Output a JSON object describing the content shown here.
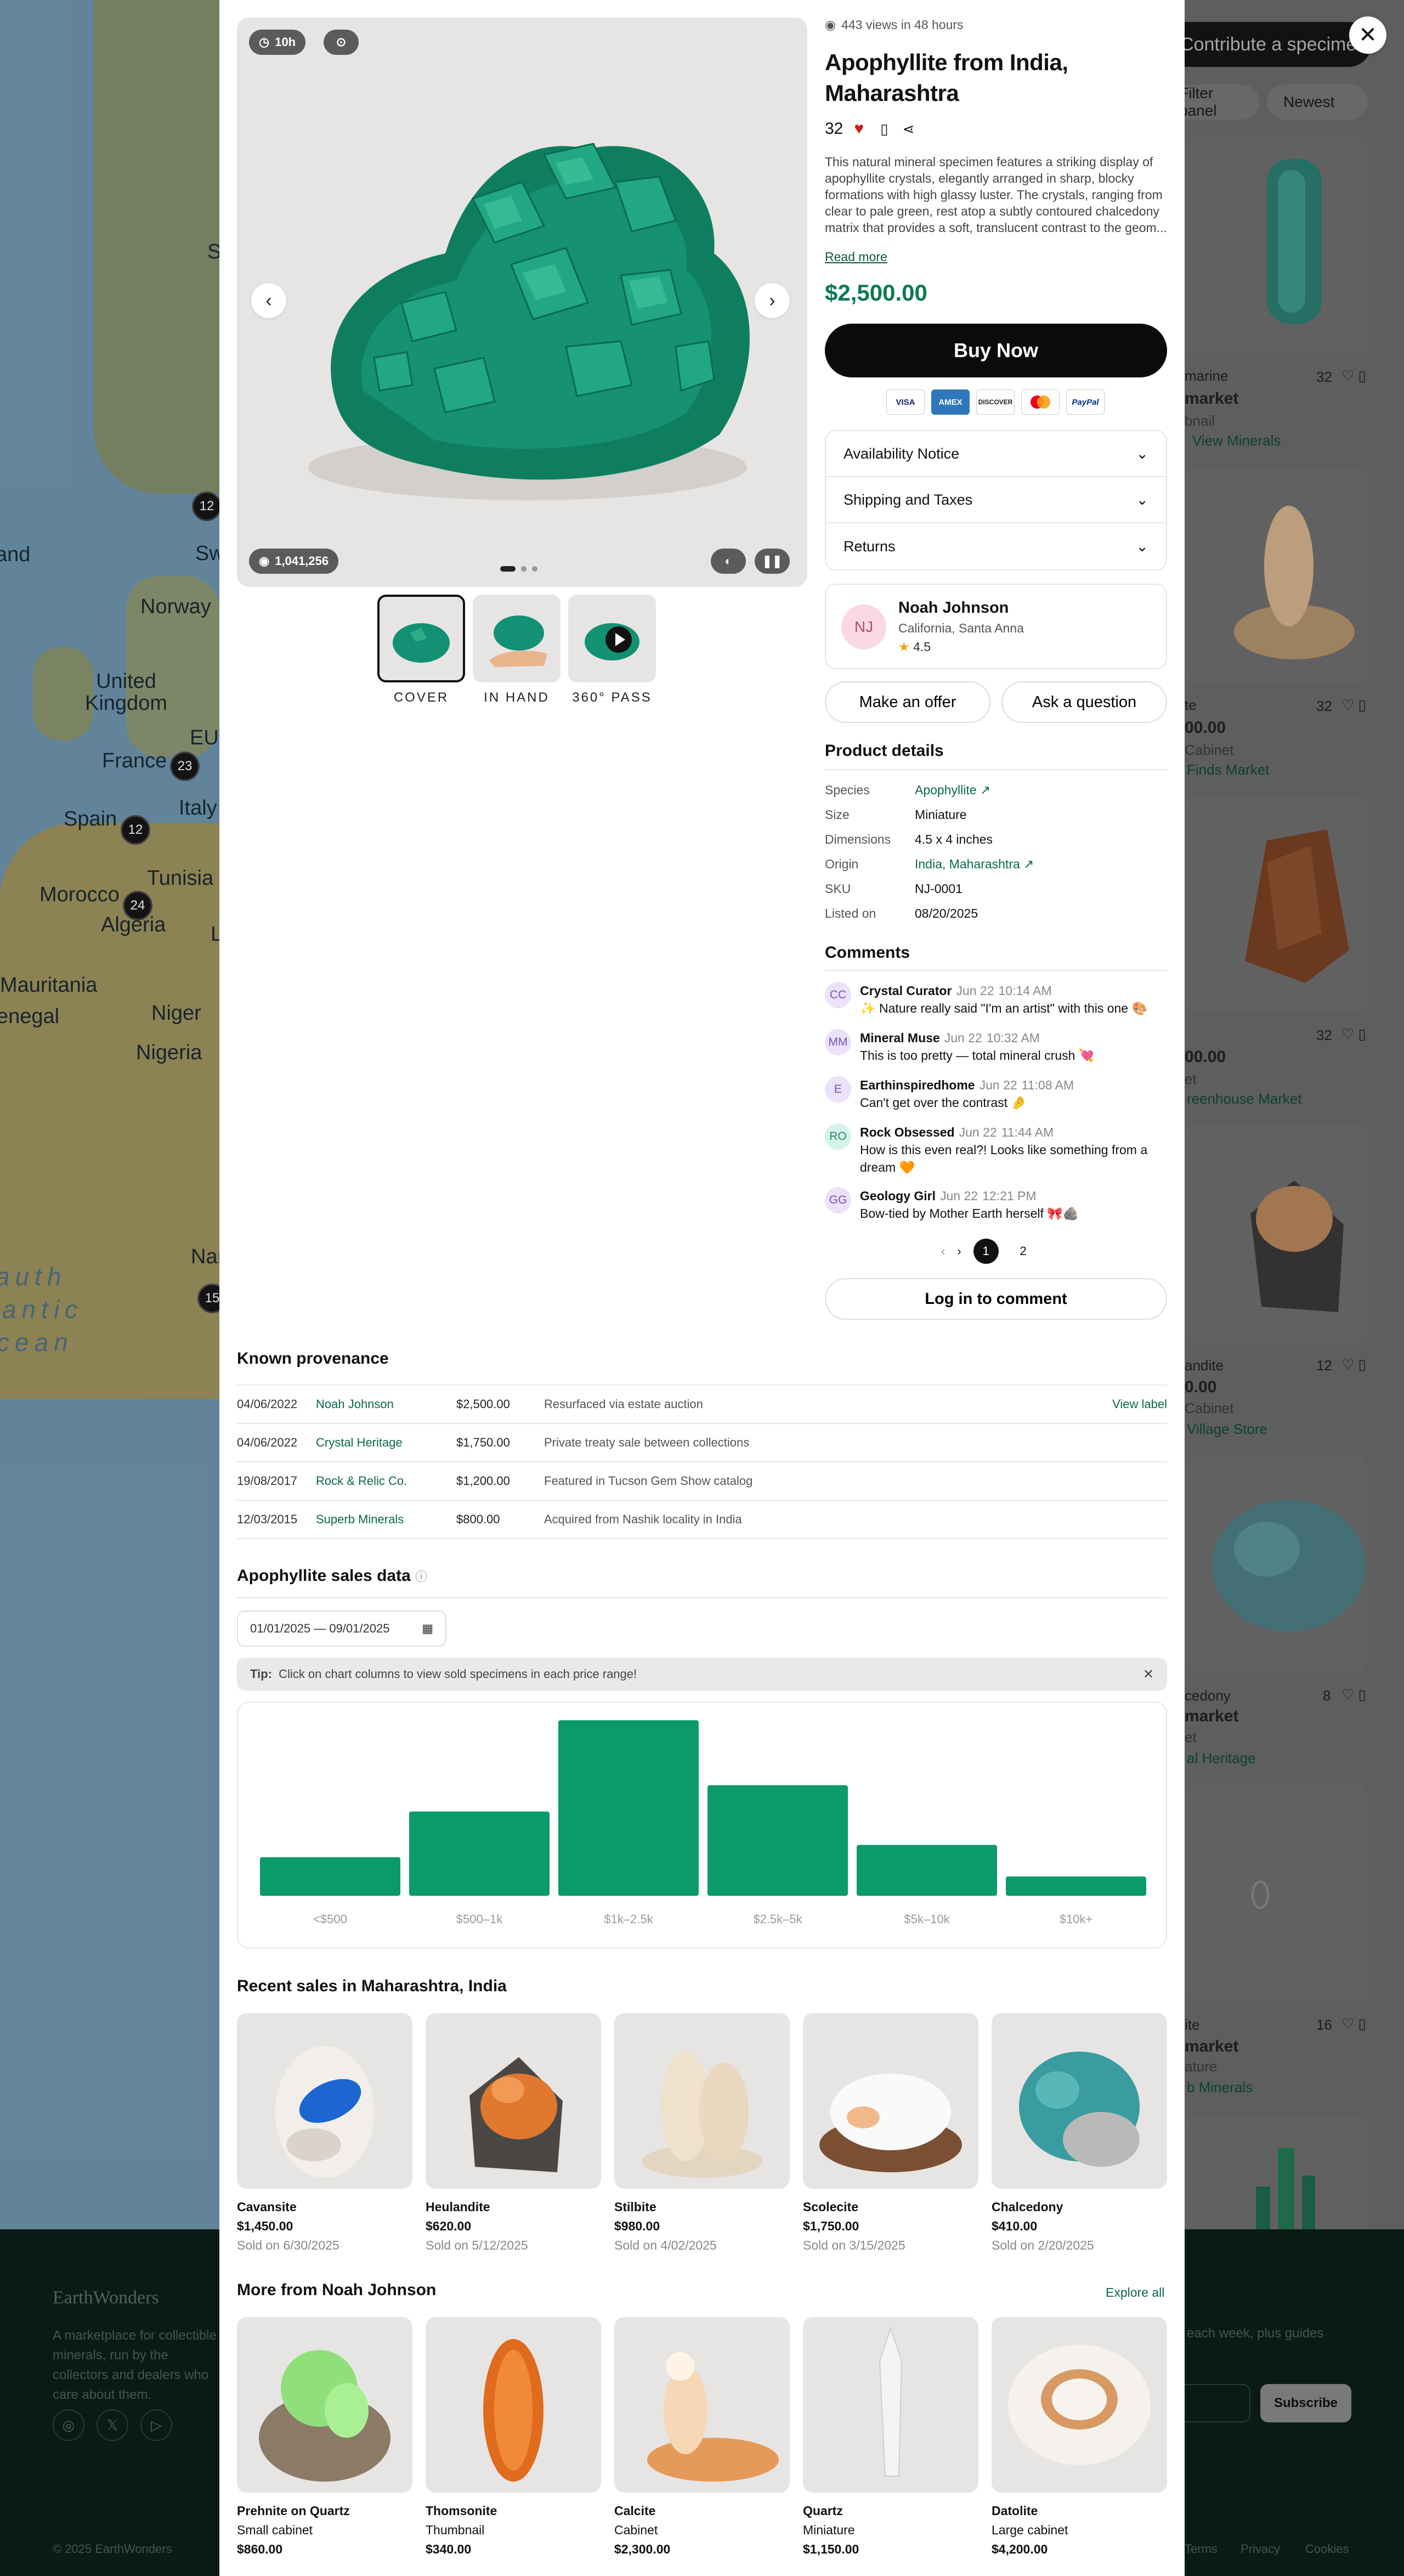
{
  "background": {
    "map_labels": [
      "and",
      "Norway",
      "United Kingdom",
      "France",
      "Spain",
      "Italy",
      "Tunisia",
      "Morocco",
      "Algeria",
      "Mauritania",
      "enegal",
      "Niger",
      "Nigeria",
      "Sw",
      "EU",
      "S",
      "L",
      "Nar"
    ],
    "ocean_label": [
      "auth",
      "antic",
      "cean"
    ],
    "clusters": [
      "12",
      "23",
      "12",
      "24",
      "15"
    ],
    "contribute_button": "Contribute a specimen",
    "filter_pill": "Filter panel",
    "sort_pill": "Newest",
    "cards": [
      {
        "type": "marine",
        "title": "market",
        "sub": "bnail",
        "link": "View Minerals",
        "likes": "32"
      },
      {
        "type": "te",
        "price": "00.00",
        "sub": "Cabinet",
        "link": "Finds Market",
        "likes": "32"
      },
      {
        "price": "00.00",
        "sub": "et",
        "link": "reenhouse Market",
        "likes": "32"
      },
      {
        "type": "andite",
        "price": "0.00",
        "sub": "Cabinet",
        "link": "Village Store",
        "likes": "12"
      },
      {
        "type": "cedony",
        "title": "market",
        "sub": "et",
        "link": "al Heritage",
        "likes": "8"
      },
      {
        "type": "ite",
        "title": "market",
        "sub": "ature",
        "link": "b Minerals",
        "likes": "16"
      }
    ],
    "footer": {
      "logo": "EarthWonders",
      "blurb": "A marketplace for collectible minerals, run by the collectors and dealers who care about them.",
      "newsletter_text": "each week, plus guides",
      "subscribe": "Subscribe",
      "copyright": "© 2025 EarthWonders",
      "links": [
        "Terms",
        "Privacy",
        "Cookies"
      ]
    }
  },
  "gallery": {
    "time_chip": "10h",
    "views_chip": "1,041,256",
    "thumbs": [
      "COVER",
      "IN HAND",
      "360° PASS"
    ]
  },
  "listing": {
    "views_meta": "443 views in 48 hours",
    "title": "Apophyllite from India, Maharashtra",
    "likes": "32",
    "description": "This natural mineral specimen features a striking display of apophyllite crystals, elegantly arranged in sharp, blocky formations with high glassy luster. The crystals, ranging from clear to pale green, rest atop a subtly contoured chalcedony matrix that provides a soft, translucent contrast to the geom...",
    "read_more": "Read more",
    "price": "$2,500.00",
    "buy_label": "Buy Now",
    "payment_methods": [
      "VISA",
      "AMEX",
      "DISCOVER",
      "MC",
      "PayPal"
    ],
    "accordion": [
      "Availability Notice",
      "Shipping and Taxes",
      "Returns"
    ]
  },
  "seller": {
    "initials": "NJ",
    "name": "Noah Johnson",
    "location": "California, Santa Anna",
    "rating": "4.5",
    "offer_label": "Make an offer",
    "question_label": "Ask a question"
  },
  "details": {
    "heading": "Product details",
    "rows": [
      {
        "k": "Species",
        "v": "Apophyllite"
      },
      {
        "k": "Size",
        "v": "Miniature"
      },
      {
        "k": "Dimensions",
        "v": "4.5 x 4 inches"
      },
      {
        "k": "Origin",
        "v": "India, Maharashtra"
      },
      {
        "k": "SKU",
        "v": "NJ-0001"
      },
      {
        "k": "Listed on",
        "v": "08/20/2025"
      }
    ]
  },
  "comments": {
    "heading": "Comments",
    "items": [
      {
        "initials": "CC",
        "name": "Crystal Curator",
        "date": "Jun 22",
        "time": "10:14 AM",
        "text": "✨ Nature really said \"I'm an artist\" with this one 🎨",
        "color": "#ece2fb"
      },
      {
        "initials": "MM",
        "name": "Mineral Muse",
        "date": "Jun 22",
        "time": "10:32 AM",
        "text": "This is too pretty — total mineral crush 💘",
        "color": "#ece2fb"
      },
      {
        "initials": "E",
        "name": "Earthinspiredhome",
        "date": "Jun 22",
        "time": "11:08 AM",
        "text": "Can't get over the contrast 🤌",
        "color": "#ece2fb"
      },
      {
        "initials": "RO",
        "name": "Rock Obsessed",
        "date": "Jun 22",
        "time": "11:44 AM",
        "text": "How is this even real?! Looks like something from a dream 🧡",
        "color": "#d6f3ea"
      },
      {
        "initials": "GG",
        "name": "Geology Girl",
        "date": "Jun 22",
        "time": "12:21 PM",
        "text": "Bow-tied by Mother Earth herself 🎀🪨",
        "color": "#ece2fb"
      }
    ],
    "pages": [
      "1",
      "2"
    ],
    "login_label": "Log in to comment"
  },
  "provenance": {
    "heading": "Known provenance",
    "view_label": "View label",
    "rows": [
      {
        "date": "04/06/2022",
        "name": "Noah Johnson",
        "price": "$2,500.00",
        "note": "Resurfaced via estate auction"
      },
      {
        "date": "04/06/2022",
        "name": "Crystal Heritage",
        "price": "$1,750.00",
        "note": "Private treaty sale between collections"
      },
      {
        "date": "19/08/2017",
        "name": "Rock & Relic Co.",
        "price": "$1,200.00",
        "note": "Featured in Tucson Gem Show catalog"
      },
      {
        "date": "12/03/2015",
        "name": "Superb Minerals",
        "price": "$800.00",
        "note": "Acquired from Nashik locality in India"
      }
    ]
  },
  "sales": {
    "heading": "Apophyllite sales data",
    "date_range": "01/01/2025 — 09/01/2025",
    "tip_bold": "Tip:",
    "tip_text": "Click on chart columns to view sold specimens in each price range!"
  },
  "chart_data": {
    "type": "bar",
    "categories": [
      "<$500",
      "$500–1k",
      "$1k–2.5k",
      "$2.5k–5k",
      "$5k–10k",
      "$10k+"
    ],
    "values": [
      22,
      48,
      100,
      63,
      29,
      11
    ],
    "ylim": [
      0,
      100
    ],
    "color": "#0b9a6a",
    "grid": false
  },
  "recent": {
    "heading": "Recent sales in Maharashtra, India",
    "items": [
      {
        "name": "Cavansite",
        "price": "$1,450.00",
        "sold": "Sold on 6/30/2025"
      },
      {
        "name": "Heulandite",
        "price": "$620.00",
        "sold": "Sold on 5/12/2025"
      },
      {
        "name": "Stilbite",
        "price": "$980.00",
        "sold": "Sold on 4/02/2025"
      },
      {
        "name": "Scolecite",
        "price": "$1,750.00",
        "sold": "Sold on 3/15/2025"
      },
      {
        "name": "Chalcedony",
        "price": "$410.00",
        "sold": "Sold on 2/20/2025"
      }
    ]
  },
  "more": {
    "heading": "More from Noah Johnson",
    "explore": "Explore all",
    "items": [
      {
        "name": "Prehnite on Quartz",
        "size": "Small cabinet",
        "price": "$860.00"
      },
      {
        "name": "Thomsonite",
        "size": "Thumbnail",
        "price": "$340.00"
      },
      {
        "name": "Calcite",
        "size": "Cabinet",
        "price": "$2,300.00"
      },
      {
        "name": "Quartz",
        "size": "Miniature",
        "price": "$1,150.00"
      },
      {
        "name": "Datolite",
        "size": "Large cabinet",
        "price": "$4,200.00"
      }
    ]
  }
}
